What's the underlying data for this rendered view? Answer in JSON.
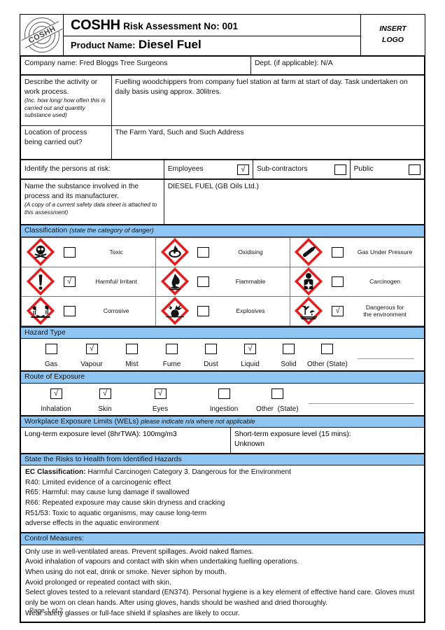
{
  "header": {
    "logo_stamp_text": "COSHH",
    "title_main": "COSHH",
    "title_sub": "Risk Assessment No: 001",
    "product_label": "Product Name:",
    "product_value": "Diesel Fuel",
    "insert_logo_line1": "INSERT",
    "insert_logo_line2": "LOGO",
    "company_label": "Company name:",
    "company_value": "Fred Bloggs Tree Surgeons",
    "dept_label": "Dept. (if applicable):",
    "dept_value": "N/A"
  },
  "activity": {
    "label_line1": "Describe the activity or",
    "label_line2": "work process.",
    "label_note": "(Inc. how long/ how often this is carried out and quantity substance used)",
    "value": "Fuelling woodchippers from company fuel station at farm at start of day. Task undertaken on daily basis using approx. 30litres."
  },
  "location": {
    "label_line1": "Location of process",
    "label_line2": "being carried out?",
    "value": "The Farm Yard, Such and Such Address"
  },
  "persons_at_risk": {
    "label": "Identify the persons at risk:",
    "options": [
      {
        "label": "Employees",
        "checked": true
      },
      {
        "label": "Sub-contractors",
        "checked": false
      },
      {
        "label": "Public",
        "checked": false
      }
    ]
  },
  "substance": {
    "label_line1": "Name the substance involved in the",
    "label_line2": "process and its manufacturer.",
    "label_note": "(A copy of a current safety data sheet is attached to this assessment)",
    "value": "DIESEL FUEL (GB Oils Ltd.)"
  },
  "classification": {
    "heading": "Classification",
    "heading_note": "(state the category of danger)",
    "items": [
      {
        "label": "Toxic",
        "icon": "ghs-skull-crossbones-icon",
        "checked": false
      },
      {
        "label": "Oxidising",
        "icon": "ghs-flame-over-circle-icon",
        "checked": false
      },
      {
        "label": "Gas Under Pressure",
        "icon": "ghs-gas-cylinder-icon",
        "checked": false
      },
      {
        "label": "Harmful/ Irritant",
        "icon": "ghs-exclamation-mark-icon",
        "checked": true
      },
      {
        "label": "Flammable",
        "icon": "ghs-flame-icon",
        "checked": false
      },
      {
        "label": "Carcinogen",
        "icon": "ghs-health-hazard-icon",
        "checked": false
      },
      {
        "label": "Corrosive",
        "icon": "ghs-corrosion-icon",
        "checked": false
      },
      {
        "label": "Explosives",
        "icon": "ghs-exploding-bomb-icon",
        "checked": false
      },
      {
        "label": "Dangerous for\nthe environment",
        "icon": "ghs-environment-icon",
        "checked": true
      }
    ]
  },
  "hazard_type": {
    "heading": "Hazard Type",
    "options": [
      {
        "label": "Gas",
        "checked": false
      },
      {
        "label": "Vapour",
        "checked": true
      },
      {
        "label": "Mist",
        "checked": false
      },
      {
        "label": "Fume",
        "checked": false
      },
      {
        "label": "Dust",
        "checked": false
      },
      {
        "label": "Liquid",
        "checked": true
      },
      {
        "label": "Solid",
        "checked": false
      },
      {
        "label": "Other",
        "checked": false
      }
    ],
    "state_label": "(State)",
    "state_value": ""
  },
  "route_of_exposure": {
    "heading": "Route of Exposure",
    "options": [
      {
        "label": "Inhalation",
        "checked": true
      },
      {
        "label": "Skin",
        "checked": true
      },
      {
        "label": "Eyes",
        "checked": true
      },
      {
        "label": "Ingestion",
        "checked": false
      },
      {
        "label": "Other",
        "checked": false
      }
    ],
    "state_label": "(State)",
    "state_value": ""
  },
  "wels": {
    "heading": "Workplace Exposure Limits (WELs)",
    "heading_note": "please indicate n/a where not applicable",
    "long_term_label": "Long-term exposure level (8hrTWA):",
    "long_term_value": "100mg/m3",
    "short_term_label": "Short-term exposure level (15 mins):",
    "short_term_value": "Unknown"
  },
  "risks": {
    "heading": "State the Risks to Health from Identified Hazards",
    "ec_label": "EC Classification:",
    "ec_value": "Harmful Carcinogen Category 3. Dangerous for the Environment",
    "lines": [
      "R40: Limited evidence of a carcinogenic effect",
      "R65: Harmful: may cause lung damage if swallowed",
      "R66: Repeated exposure may cause skin dryness and cracking",
      "R51/53: Toxic to aquatic organisms, may cause long-term",
      "adverse effects in the aquatic environment"
    ]
  },
  "control_measures": {
    "heading": "Control Measures:",
    "lines": [
      "Only use in well-ventilated areas. Prevent spillages. Avoid naked flames.",
      "Avoid inhalation of vapours and contact with skin when undertaking fuelling operations.",
      "When using do not eat, drink or smoke. Never siphon by mouth.",
      "Avoid prolonged or repeated contact with skin.",
      "Select gloves tested to a relevant standard (EN374). Personal hygiene is a key element of effective hand care. Gloves must only be worn on clean hands. After using gloves, hands should be washed and dried thoroughly.",
      "Wear safety glasses or full-face shield if splashes are likely to occur."
    ]
  },
  "footer": {
    "page_text": "Page 1 of 2"
  },
  "colors": {
    "section_bar": "#8EC5F2",
    "pictogram_border": "#E02020",
    "text": "#111111"
  }
}
